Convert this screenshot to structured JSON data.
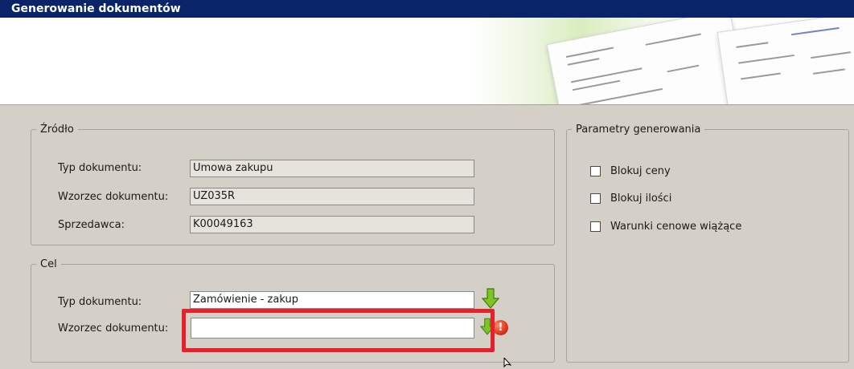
{
  "window": {
    "title": "Generowanie dokumentów"
  },
  "source": {
    "legend": "Źródło",
    "doc_type_label": "Typ dokumentu:",
    "doc_type_value": "Umowa zakupu",
    "template_label": "Wzorzec dokumentu:",
    "template_value": "UZ035R",
    "seller_label": "Sprzedawca:",
    "seller_value": "K00049163"
  },
  "target": {
    "legend": "Cel",
    "doc_type_label": "Typ dokumentu:",
    "doc_type_value": "Zamówienie - zakup",
    "template_label": "Wzorzec dokumentu:",
    "template_value": ""
  },
  "params": {
    "legend": "Parametry generowania",
    "options": [
      {
        "label": "Blokuj ceny",
        "checked": false
      },
      {
        "label": "Blokuj ilości",
        "checked": false
      },
      {
        "label": "Warunki cenowe wiążące",
        "checked": false
      }
    ]
  },
  "icons": {
    "error_glyph": "!",
    "arrow": "green-down-arrow-icon",
    "error": "error-icon"
  },
  "colors": {
    "title_bar": "#0a246a",
    "highlight": "#e8202a",
    "arrow": "#7cc623",
    "error": "#e03a1c"
  }
}
